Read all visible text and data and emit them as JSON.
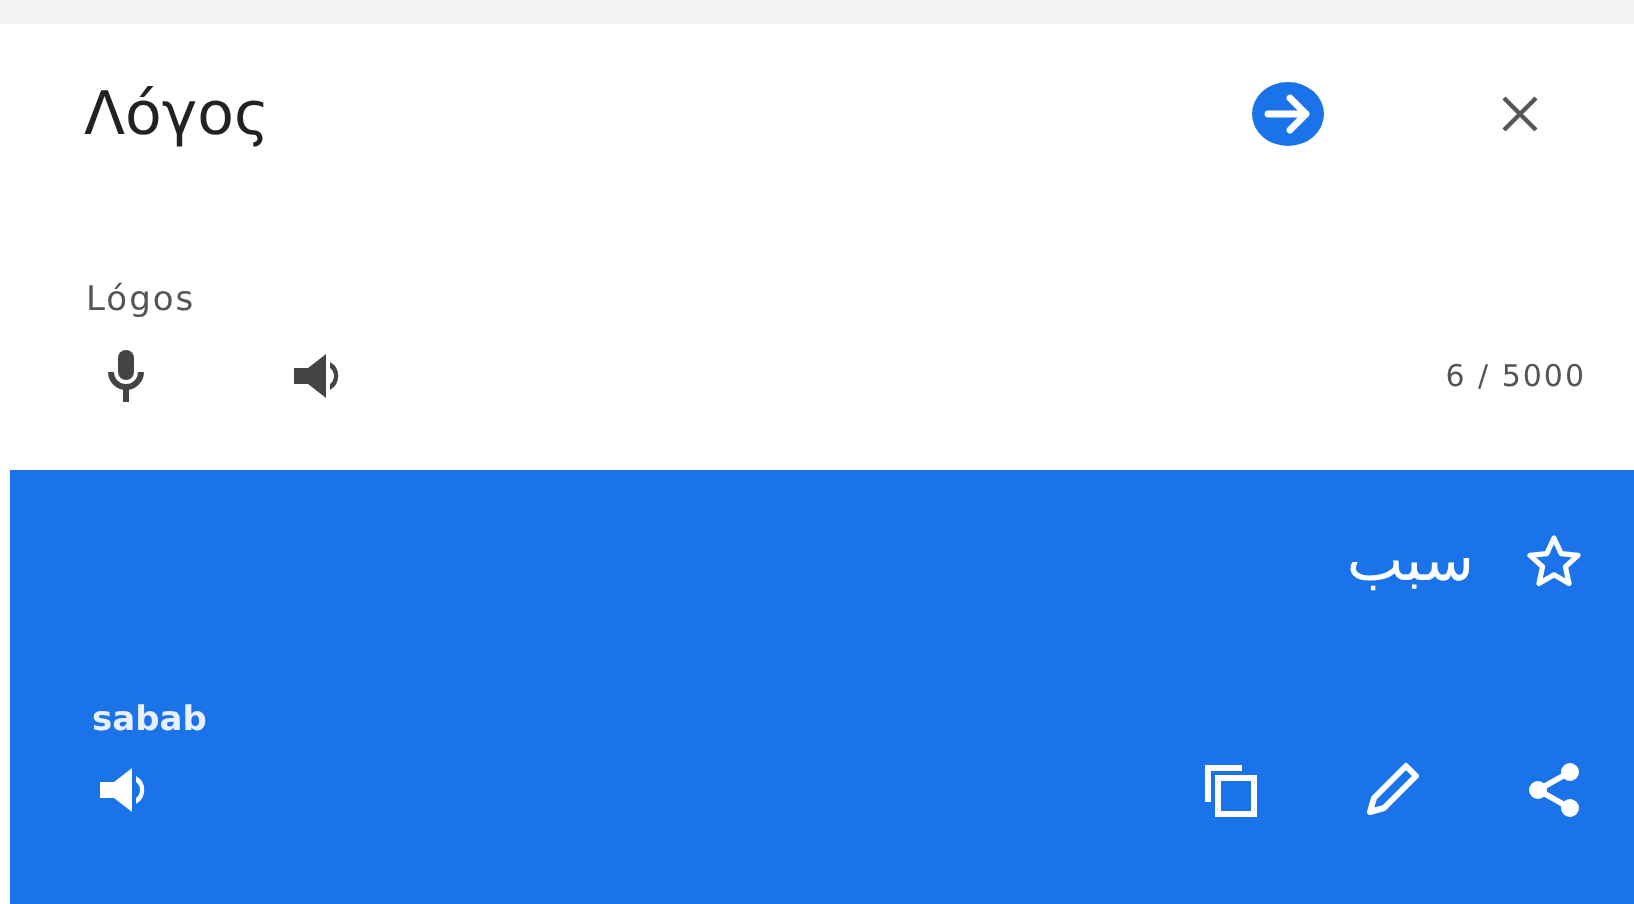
{
  "source": {
    "text": "Λόγος",
    "transliteration": "Lógos",
    "char_count": "6 / 5000"
  },
  "translation": {
    "text": "سبب",
    "transliteration": "sabab",
    "saved": false
  }
}
